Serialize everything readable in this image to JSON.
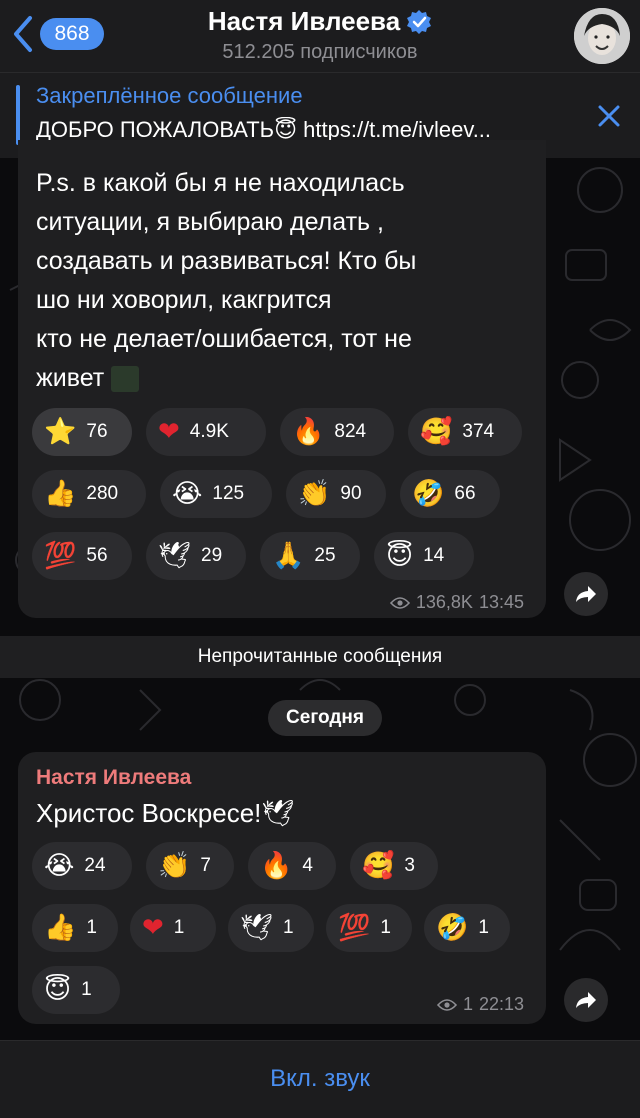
{
  "header": {
    "back_count": "868",
    "title": "Настя Ивлеева",
    "subtitle": "512.205 подписчиков",
    "verified": true
  },
  "pinned": {
    "title": "Закреплённое сообщение",
    "text": "ДОБРО ПОЖАЛОВАТЬ😇 https://t.me/ivleev..."
  },
  "message1": {
    "text_lines": [
      "P.s. в какой бы я не находилась",
      "ситуации, я выбираю делать ,",
      "создавать и развиваться! Кто бы",
      "шо ни ховорил, какгрится",
      "кто не делает/ошибается, тот не",
      "живет"
    ],
    "reactions": [
      [
        {
          "emoji": "⭐",
          "count": "76"
        },
        {
          "emoji": "❤",
          "count": "4.9K"
        },
        {
          "emoji": "🔥",
          "count": "824"
        },
        {
          "emoji": "🥰",
          "count": "374"
        }
      ],
      [
        {
          "emoji": "👍",
          "count": "280"
        },
        {
          "emoji": "😭",
          "count": "125"
        },
        {
          "emoji": "👏",
          "count": "90"
        },
        {
          "emoji": "🤣",
          "count": "66"
        }
      ],
      [
        {
          "emoji": "💯",
          "count": "56"
        },
        {
          "emoji": "🕊",
          "count": "29"
        },
        {
          "emoji": "🙏",
          "count": "25"
        },
        {
          "emoji": "😇",
          "count": "14"
        }
      ]
    ],
    "views": "136,8K",
    "time": "13:45"
  },
  "divider": {
    "unread": "Непрочитанные сообщения",
    "date": "Сегодня"
  },
  "message2": {
    "sender": "Настя Ивлеева",
    "text": "Христос Воскресе!🕊",
    "reactions": [
      [
        {
          "emoji": "😭",
          "count": "24"
        },
        {
          "emoji": "👏",
          "count": "7"
        },
        {
          "emoji": "🔥",
          "count": "4"
        },
        {
          "emoji": "🥰",
          "count": "3"
        }
      ],
      [
        {
          "emoji": "👍",
          "count": "1"
        },
        {
          "emoji": "❤",
          "count": "1"
        },
        {
          "emoji": "🕊",
          "count": "1"
        },
        {
          "emoji": "💯",
          "count": "1"
        },
        {
          "emoji": "🤣",
          "count": "1"
        }
      ],
      [
        {
          "emoji": "😇",
          "count": "1"
        }
      ]
    ],
    "views": "1",
    "time": "22:13"
  },
  "footer": {
    "label": "Вкл. звук"
  },
  "colors": {
    "accent": "#4a8ef0",
    "bubble": "#1f1f21",
    "sender": "#ee7b7b"
  }
}
